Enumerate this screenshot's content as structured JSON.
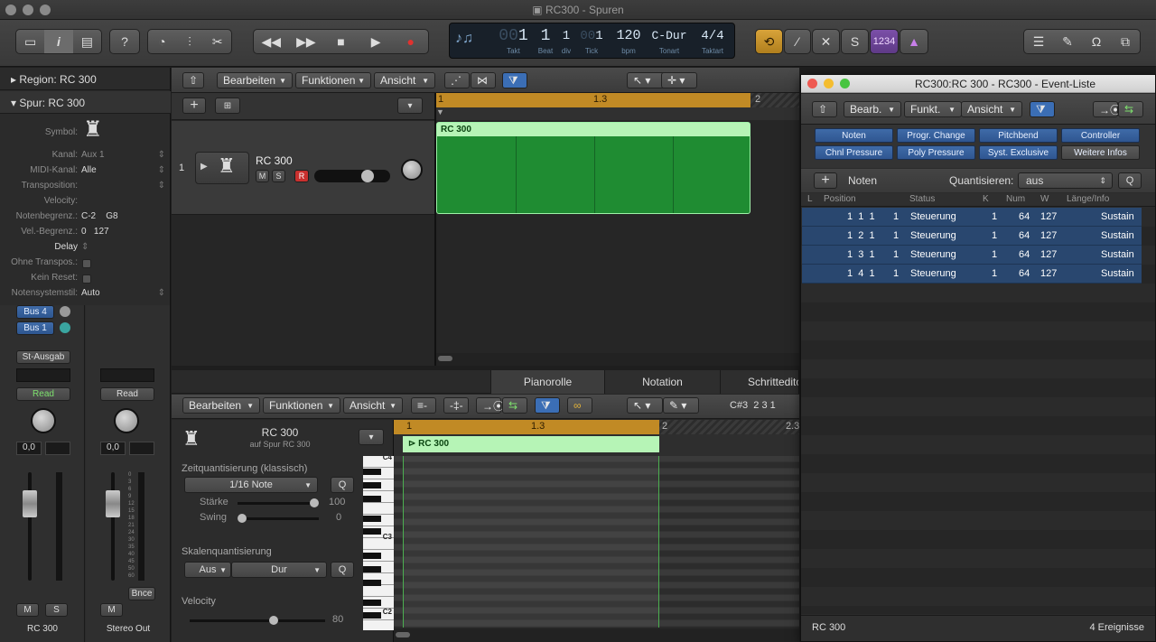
{
  "window": {
    "title": "RC300 - Spuren"
  },
  "toolbar": {
    "lcd": {
      "bar": "1",
      "beat": "1",
      "div": "1",
      "tick": "1",
      "tempo": "120",
      "key": "C-Dur",
      "signature": "4/4",
      "bar_label": "Takt",
      "beat_label": "Beat",
      "div_label": "div",
      "tick_label": "Tick",
      "tempo_label": "bpm",
      "key_label": "Tonart",
      "sig_label": "Taktart",
      "bar_prefix": "00",
      "tick_prefix": "00"
    },
    "count_in": "1234"
  },
  "inspector": {
    "region_header": "Region: RC 300",
    "track_header": "Spur: RC 300",
    "symbol_label": "Symbol:",
    "rows": [
      {
        "key": "Kanal:",
        "value": "Aux 1"
      },
      {
        "key": "MIDI-Kanal:",
        "value": "Alle"
      },
      {
        "key": "Transposition:",
        "value": ""
      },
      {
        "key": "Velocity:",
        "value": ""
      },
      {
        "key": "Notenbegrenz.:",
        "value": "C-2    G8"
      },
      {
        "key": "Vel.-Begrenz.:",
        "value": "0   127"
      },
      {
        "key": "Delay",
        "value": ""
      },
      {
        "key": "Ohne Transpos.:",
        "value": ""
      },
      {
        "key": "Kein Reset:",
        "value": ""
      },
      {
        "key": "Notensystemstil:",
        "value": "Auto"
      }
    ],
    "strip1": {
      "bus_a": "Bus 4",
      "bus_b": "Bus 1",
      "output": "St-Ausgab",
      "read": "Read",
      "pan": "0,0",
      "mute": "M",
      "solo": "S",
      "name": "RC 300"
    },
    "strip2": {
      "read": "Read",
      "pan": "0,0",
      "bounce": "Bnce",
      "mute": "M",
      "name": "Stereo Out"
    },
    "meter_scale": [
      "0",
      "3",
      "6",
      "9",
      "12",
      "15",
      "18",
      "21",
      "24",
      "30",
      "35",
      "40",
      "45",
      "50",
      "60"
    ]
  },
  "tracks": {
    "menus": [
      "Bearbeiten",
      "Funktionen",
      "Ansicht"
    ],
    "track": {
      "number": "1",
      "name": "RC 300",
      "mute": "M",
      "solo": "S",
      "rec": "R"
    },
    "ruler": {
      "m1": "1",
      "m13": "1.3",
      "m2": "2"
    },
    "region_name": "RC 300"
  },
  "editor": {
    "tabs": [
      "Pianorolle",
      "Notation",
      "Schrittedito"
    ],
    "menus": [
      "Bearbeiten",
      "Funktionen",
      "Ansicht"
    ],
    "position": "C#3  2 3 1",
    "region_title": "RC 300",
    "region_sub": "auf Spur RC 300",
    "timequant_label": "Zeitquantisierung (klassisch)",
    "timequant_value": "1/16 Note",
    "q": "Q",
    "strength_label": "Stärke",
    "strength_value": "100",
    "swing_label": "Swing",
    "swing_value": "0",
    "scalequant_label": "Skalenquantisierung",
    "scale_a": "Aus",
    "scale_b": "Dur",
    "velocity_label": "Velocity",
    "velocity_value": "80",
    "ruler": {
      "m1": "1",
      "m13": "1.3",
      "m2": "2",
      "m23": "2.3"
    },
    "region_name": "RC 300",
    "keys": {
      "c4": "C4",
      "c3": "C3",
      "c2": "C2"
    },
    "strength_fraction": 1.0,
    "swing_fraction": 0.0,
    "velocity_fraction": 0.63
  },
  "eventlist": {
    "title": "RC300:RC 300 - RC300 - Event-Liste",
    "menus": [
      "Bearb.",
      "Funkt.",
      "Ansicht"
    ],
    "filters": [
      "Noten",
      "Progr. Change",
      "Pitchbend",
      "Controller",
      "Chnl Pressure",
      "Poly Pressure",
      "Syst. Exclusive",
      "Weitere Infos"
    ],
    "create_label": "Noten",
    "quant_label": "Quantisieren:",
    "quant_value": "aus",
    "q": "Q",
    "columns": [
      "L",
      "Position",
      "Status",
      "K",
      "Num",
      "W",
      "Länge/Info"
    ],
    "rows": [
      {
        "pos": "1  1  1",
        "tick": "1",
        "status": "Steuerung",
        "ch": "1",
        "num": "64",
        "val": "127",
        "info": "Sustain"
      },
      {
        "pos": "1  2  1",
        "tick": "1",
        "status": "Steuerung",
        "ch": "1",
        "num": "64",
        "val": "127",
        "info": "Sustain"
      },
      {
        "pos": "1  3  1",
        "tick": "1",
        "status": "Steuerung",
        "ch": "1",
        "num": "64",
        "val": "127",
        "info": "Sustain"
      },
      {
        "pos": "1  4  1",
        "tick": "1",
        "status": "Steuerung",
        "ch": "1",
        "num": "64",
        "val": "127",
        "info": "Sustain"
      }
    ],
    "footer_left": "RC 300",
    "footer_right": "4 Ereignisse"
  }
}
